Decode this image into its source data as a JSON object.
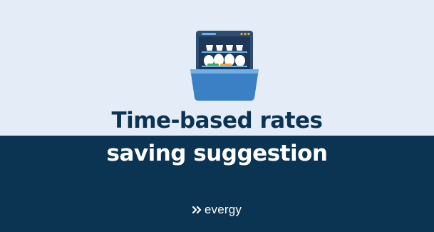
{
  "slide": {
    "illustration": {
      "icon": "dishwasher-icon"
    },
    "title_line_1": "Time-based rates",
    "title_line_2": "saving suggestion",
    "brand": {
      "icon": "double-chevron-icon",
      "name": "evergy"
    },
    "colors": {
      "background_light": "#e4edf7",
      "background_dark": "#0b3352",
      "accent_blue": "#3b7fc4",
      "accent_green": "#3fae49",
      "accent_orange": "#f5a623"
    }
  }
}
